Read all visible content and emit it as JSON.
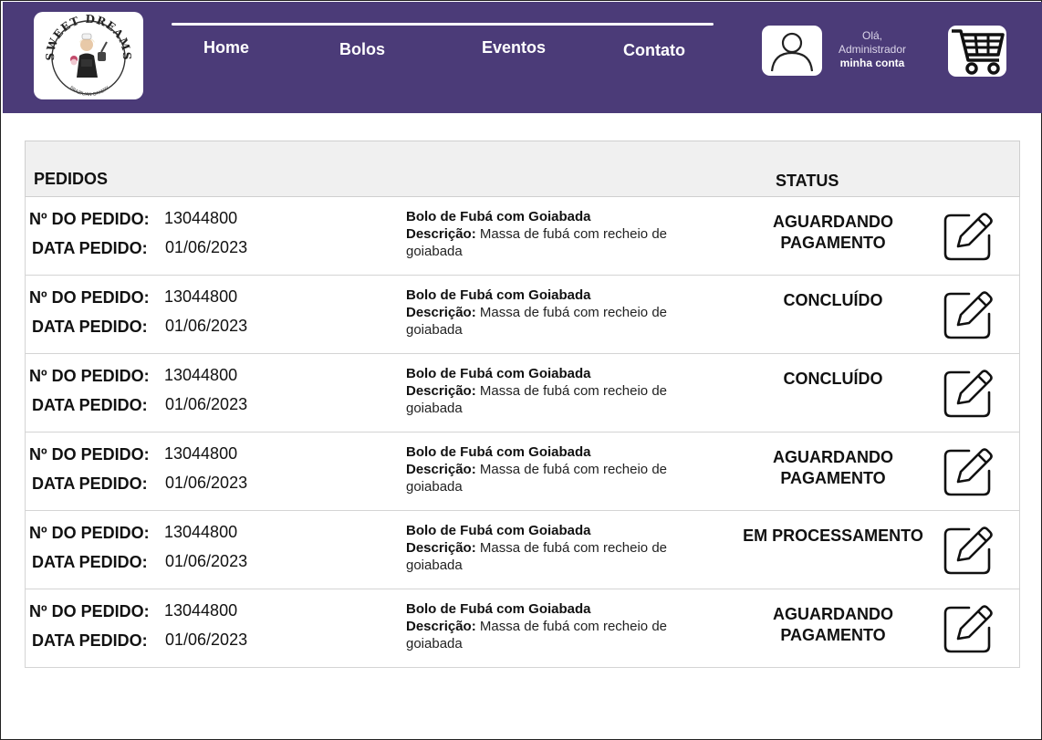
{
  "brand": {
    "logo_text": "SWEET DREAMS",
    "logo_subtext": "BRAZILIAN BAKERY"
  },
  "nav": {
    "items": [
      "Home",
      "Bolos",
      "Eventos",
      "Contato"
    ]
  },
  "account": {
    "greeting": "Olá,",
    "user": "Administrador",
    "link": "minha conta"
  },
  "table": {
    "header_orders": "PEDIDOS",
    "header_status": "STATUS",
    "label_order_no": "Nº DO PEDIDO:",
    "label_order_date": "DATA PEDIDO:",
    "label_description": "Descrição:",
    "rows": [
      {
        "order_no": "13044800",
        "date": "01/06/2023",
        "product": "Bolo de Fubá com Goiabada",
        "description": "Massa de fubá com recheio de goiabada",
        "status": "AGUARDANDO PAGAMENTO"
      },
      {
        "order_no": "13044800",
        "date": "01/06/2023",
        "product": "Bolo de Fubá com Goiabada",
        "description": "Massa de fubá com recheio de goiabada",
        "status": "CONCLUÍDO"
      },
      {
        "order_no": "13044800",
        "date": "01/06/2023",
        "product": "Bolo de Fubá com Goiabada",
        "description": "Massa de fubá com recheio de goiabada",
        "status": "CONCLUÍDO"
      },
      {
        "order_no": "13044800",
        "date": "01/06/2023",
        "product": "Bolo de Fubá com Goiabada",
        "description": "Massa de fubá com recheio de goiabada",
        "status": "AGUARDANDO PAGAMENTO"
      },
      {
        "order_no": "13044800",
        "date": "01/06/2023",
        "product": "Bolo de Fubá com Goiabada",
        "description": "Massa de fubá com recheio de goiabada",
        "status": "EM PROCESSAMENTO"
      },
      {
        "order_no": "13044800",
        "date": "01/06/2023",
        "product": "Bolo de Fubá com Goiabada",
        "description": "Massa de fubá com recheio de goiabada",
        "status": "AGUARDANDO PAGAMENTO"
      }
    ]
  },
  "colors": {
    "header_bg": "#4b3b78",
    "table_header_bg": "#f0f0f0"
  },
  "icons": {
    "user": "user-icon",
    "cart": "cart-icon",
    "edit": "edit-icon"
  }
}
